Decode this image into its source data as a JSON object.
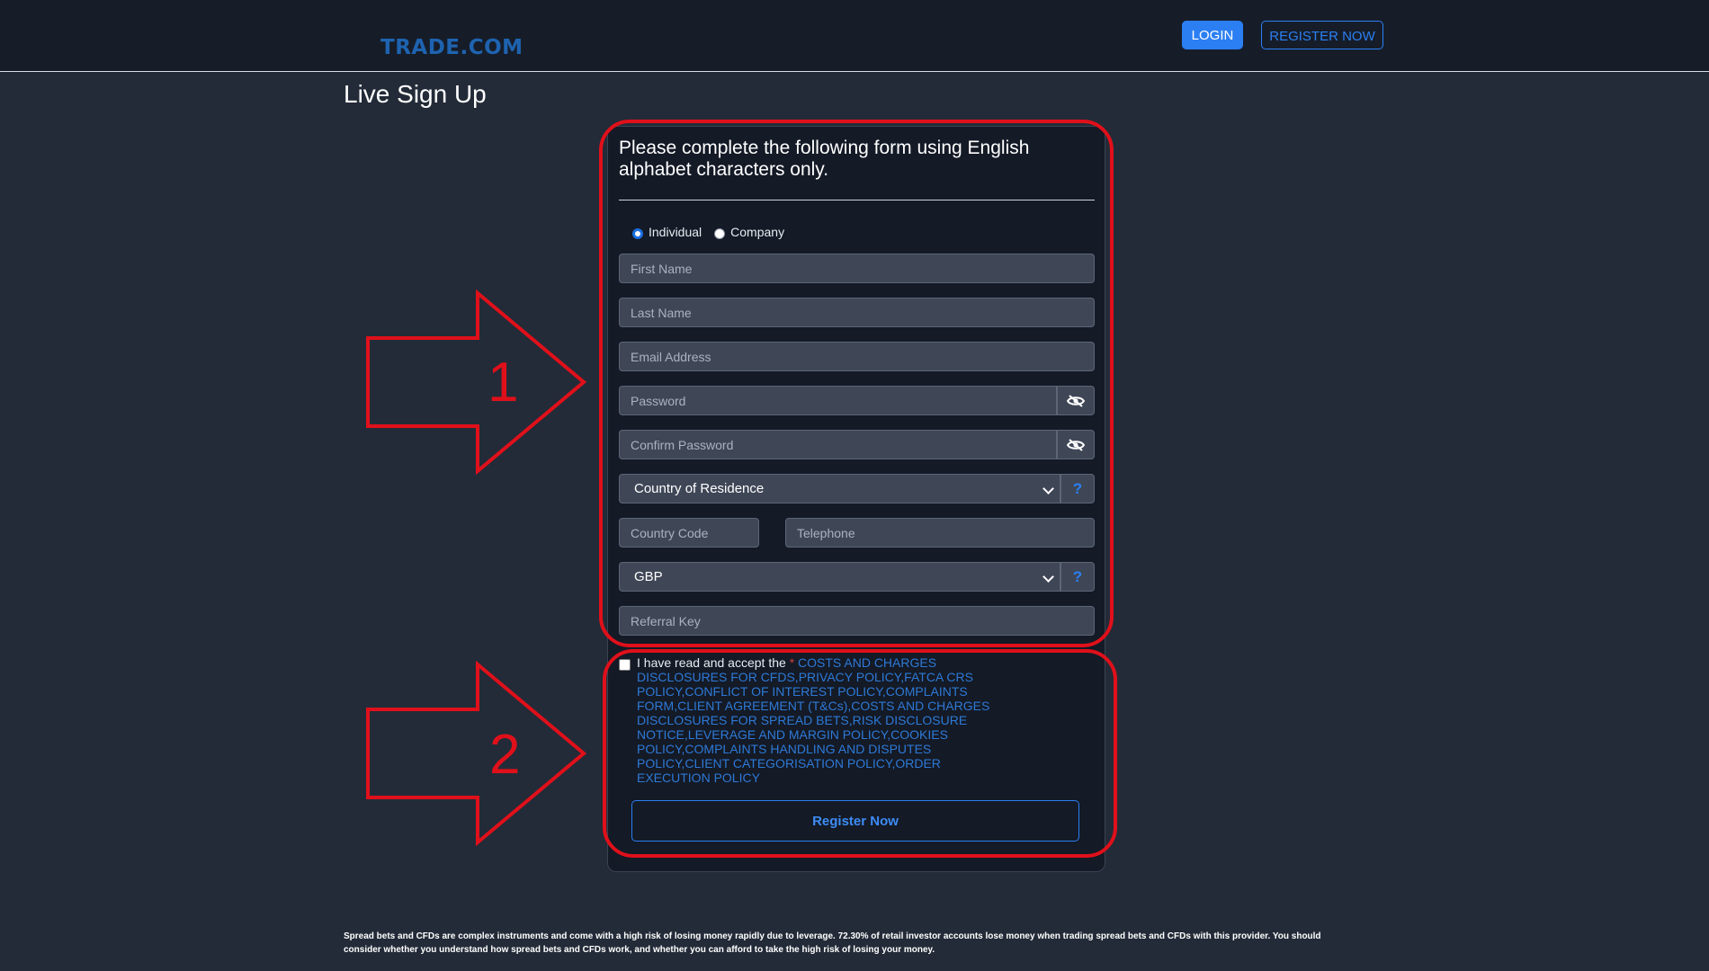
{
  "header": {
    "logo_text": "TRADE.COM",
    "login_label": "LOGIN",
    "register_label": "REGISTER NOW"
  },
  "page": {
    "title": "Live Sign Up"
  },
  "form": {
    "intro": "Please complete the following form using English alphabet characters only.",
    "account_types": [
      {
        "label": "Individual",
        "selected": true
      },
      {
        "label": "Company",
        "selected": false
      }
    ],
    "first_name_placeholder": "First Name",
    "last_name_placeholder": "Last Name",
    "email_placeholder": "Email Address",
    "password_placeholder": "Password",
    "confirm_password_placeholder": "Confirm Password",
    "country_selected": "Country of Residence",
    "country_code_placeholder": "Country Code",
    "telephone_placeholder": "Telephone",
    "currency_selected": "GBP",
    "referral_placeholder": "Referral Key",
    "help_symbol": "?",
    "terms_prefix": "I have read and accept the ",
    "terms_required_mark": "*",
    "terms_links": " COSTS AND CHARGES DISCLOSURES FOR CFDS,PRIVACY POLICY,FATCA CRS POLICY,CONFLICT OF INTEREST POLICY,COMPLAINTS FORM,CLIENT AGREEMENT (T&Cs),COSTS AND CHARGES DISCLOSURES FOR SPREAD BETS,RISK DISCLOSURE NOTICE,LEVERAGE AND MARGIN POLICY,COOKIES POLICY,COMPLAINTS HANDLING AND DISPUTES POLICY,CLIENT CATEGORISATION POLICY,ORDER EXECUTION POLICY",
    "submit_label": "Register Now"
  },
  "annotations": {
    "marker_1": "1",
    "marker_2": "2",
    "color": "#e0101a"
  },
  "footer": {
    "risk_warning": "Spread bets and CFDs are complex instruments and come with a high risk of losing money rapidly due to leverage. 72.30% of retail investor accounts lose money when trading spread bets and CFDs with this provider. You should consider whether you understand how spread bets and CFDs work, and whether you can afford to take the high risk of losing your money."
  },
  "colors": {
    "background": "#232b38",
    "topbar": "#161d29",
    "accent": "#2b7ff3",
    "field": "#3f4757"
  },
  "icons": [
    "eye-slash-icon",
    "question-icon",
    "chevron-down-icon"
  ]
}
